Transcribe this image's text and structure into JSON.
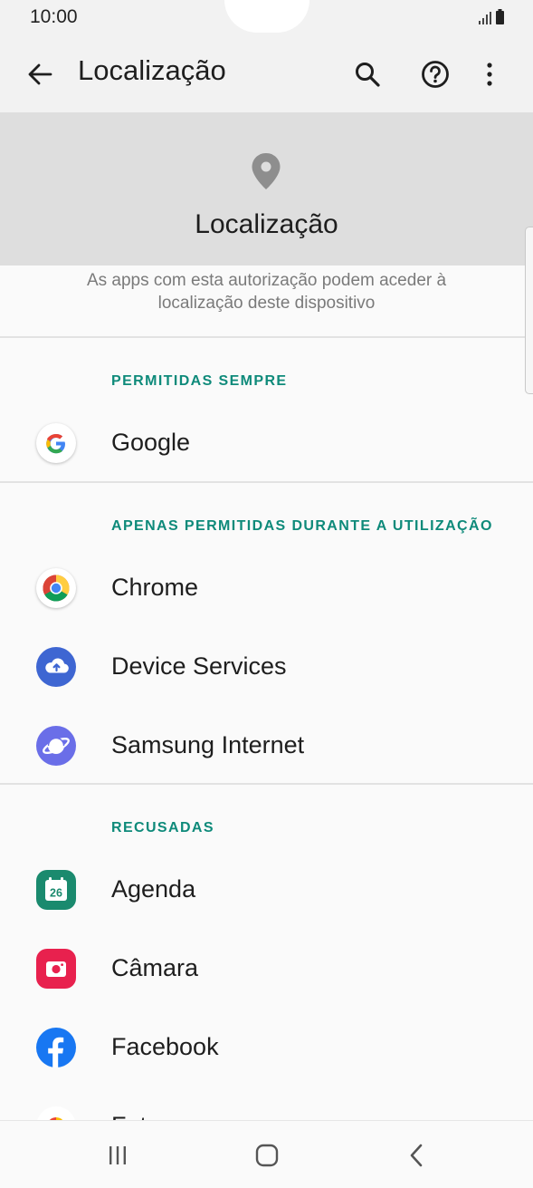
{
  "status": {
    "time": "10:00"
  },
  "appbar": {
    "title": "Localização"
  },
  "hero": {
    "title": "Localização",
    "description": "As apps com esta autorização podem aceder à localização deste dispositivo"
  },
  "sections": [
    {
      "header": "PERMITIDAS SEMPRE",
      "apps": [
        {
          "label": "Google",
          "icon": "google-icon"
        }
      ]
    },
    {
      "header": "APENAS PERMITIDAS DURANTE A UTILIZAÇÃO",
      "apps": [
        {
          "label": "Chrome",
          "icon": "chrome-icon"
        },
        {
          "label": "Device Services",
          "icon": "device-services-icon"
        },
        {
          "label": "Samsung Internet",
          "icon": "samsung-internet-icon"
        }
      ]
    },
    {
      "header": "RECUSADAS",
      "apps": [
        {
          "label": "Agenda",
          "icon": "calendar-icon",
          "icon_text": "26"
        },
        {
          "label": "Câmara",
          "icon": "camera-icon"
        },
        {
          "label": "Facebook",
          "icon": "facebook-icon"
        },
        {
          "label": "Fotos",
          "icon": "photos-icon"
        }
      ]
    }
  ],
  "colors": {
    "accent": "#0e8a7a",
    "hero_bg": "#dedede",
    "calendar": "#1a8a6e",
    "camera": "#e8214e",
    "facebook": "#1877f2",
    "device_services": "#3e66d2",
    "samsung_internet": "#6a6ee8"
  }
}
